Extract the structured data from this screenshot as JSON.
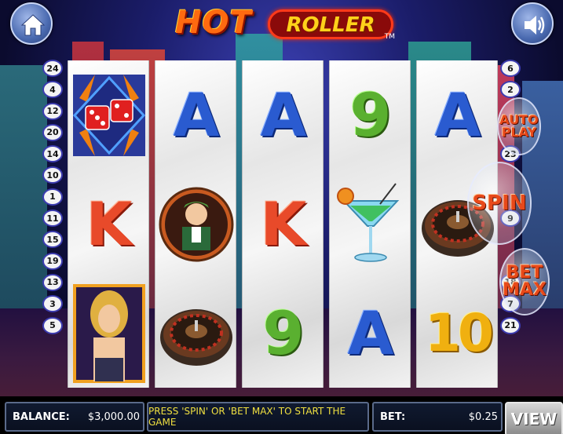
{
  "logo": {
    "hot": "HOT",
    "roller": "ROLLER",
    "tm": "TM"
  },
  "left_paylines": [
    "24",
    "4",
    "12",
    "20",
    "14",
    "10",
    "1",
    "11",
    "15",
    "19",
    "13",
    "3",
    "5"
  ],
  "right_paylines": [
    "6",
    "2",
    "",
    "",
    "23",
    "",
    "",
    "9",
    "",
    "",
    "18",
    "7",
    "21"
  ],
  "reels": [
    {
      "symbols": [
        {
          "type": "dice",
          "label": ""
        },
        {
          "type": "K",
          "label": "K"
        },
        {
          "type": "lady",
          "label": ""
        }
      ]
    },
    {
      "symbols": [
        {
          "type": "A",
          "label": "A"
        },
        {
          "type": "dealer",
          "label": ""
        },
        {
          "type": "roulette",
          "label": ""
        }
      ]
    },
    {
      "symbols": [
        {
          "type": "A",
          "label": "A"
        },
        {
          "type": "K",
          "label": "K"
        },
        {
          "type": "9",
          "label": "9"
        }
      ]
    },
    {
      "symbols": [
        {
          "type": "9",
          "label": "9"
        },
        {
          "type": "martini",
          "label": ""
        },
        {
          "type": "A",
          "label": "A"
        }
      ]
    },
    {
      "symbols": [
        {
          "type": "A",
          "label": "A"
        },
        {
          "type": "roulette",
          "label": ""
        },
        {
          "type": "10",
          "label": "10"
        }
      ]
    }
  ],
  "buttons": {
    "auto_play_line1": "AUTO",
    "auto_play_line2": "PLAY",
    "spin": "SPIN",
    "bet_max_line1": "BET",
    "bet_max_line2": "MAX",
    "view": "VIEW"
  },
  "status": {
    "balance_label": "BALANCE:",
    "balance_value": "$3,000.00",
    "message": "PRESS 'SPIN' OR 'BET MAX' TO START THE GAME",
    "bet_label": "BET:",
    "bet_value": "$0.25"
  },
  "icons": {
    "home": "home-icon",
    "sound": "speaker-icon"
  },
  "colors": {
    "accent_red": "#e8491a",
    "payline_border": "#3c3cb0",
    "message_text": "#f0e040"
  }
}
